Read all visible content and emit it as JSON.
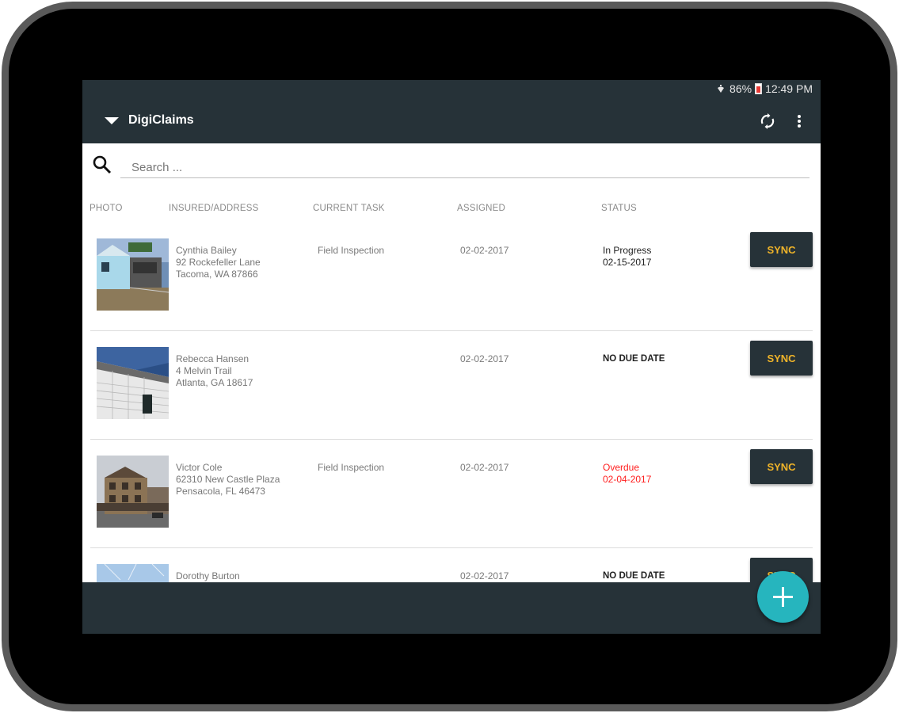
{
  "status_bar": {
    "battery": "86%",
    "time": "12:49 PM"
  },
  "app_bar": {
    "title": "DigiClaims"
  },
  "search": {
    "placeholder": "Search ..."
  },
  "columns": [
    "PHOTO",
    "INSURED/ADDRESS",
    "CURRENT TASK",
    "ASSIGNED",
    "STATUS"
  ],
  "rows": [
    {
      "name": "Cynthia Bailey",
      "street": "92 Rockefeller Lane",
      "city": "Tacoma, WA 87866",
      "task": "Field Inspection",
      "assigned": "02-02-2017",
      "status": "In Progress",
      "status_date": "02-15-2017",
      "status_type": "in-progress",
      "sync_label": "SYNC"
    },
    {
      "name": "Rebecca Hansen",
      "street": "4 Melvin Trail",
      "city": "Atlanta, GA 18617",
      "task": "",
      "assigned": "02-02-2017",
      "status": "NO DUE DATE",
      "status_date": "",
      "status_type": "no-due-date",
      "sync_label": "SYNC"
    },
    {
      "name": "Victor Cole",
      "street": "62310 New Castle Plaza",
      "city": "Pensacola, FL 46473",
      "task": "Field Inspection",
      "assigned": "02-02-2017",
      "status": "Overdue",
      "status_date": "02-04-2017",
      "status_type": "overdue",
      "sync_label": "SYNC"
    },
    {
      "name": "Dorothy Burton",
      "street": "",
      "city": "",
      "task": "",
      "assigned": "02-02-2017",
      "status": "NO DUE DATE",
      "status_date": "",
      "status_type": "no-due-date",
      "sync_label": "SYNC"
    }
  ],
  "colors": {
    "toolbar": "#263238",
    "sync_text": "#f0b429",
    "fab": "#26b5be",
    "overdue": "#ff1f1f"
  }
}
